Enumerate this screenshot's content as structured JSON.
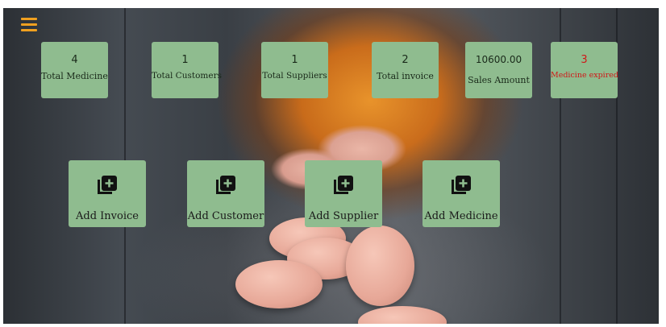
{
  "stats": [
    {
      "value": "4",
      "label": "Total Medicine"
    },
    {
      "value": "1",
      "label": "Total Customers"
    },
    {
      "value": "1",
      "label": "Total Suppliers"
    },
    {
      "value": "2",
      "label": "Total invoice"
    },
    {
      "value": "10600.00",
      "label": "Sales Amount"
    },
    {
      "value": "3",
      "label": "Medicine expired"
    }
  ],
  "actions": [
    {
      "label": "Add Invoice",
      "icon": "add-to-library-icon"
    },
    {
      "label": "Add Customer",
      "icon": "add-to-library-icon"
    },
    {
      "label": "Add Supplier",
      "icon": "add-to-library-icon"
    },
    {
      "label": "Add Medicine",
      "icon": "add-to-library-icon"
    }
  ],
  "colors": {
    "card": "#8fbc8f",
    "menu": "#f0a020",
    "danger": "#d01818"
  },
  "menu_icon": "hamburger-menu-icon"
}
